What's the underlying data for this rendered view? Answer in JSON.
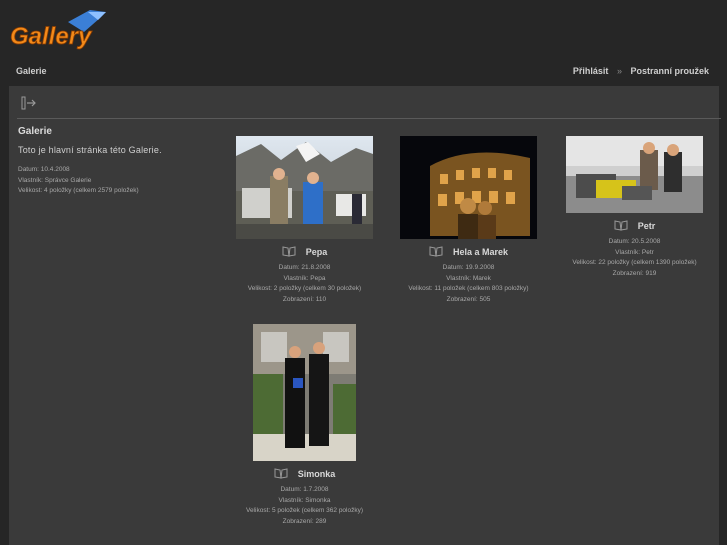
{
  "header": {
    "logo_text": "Gallery",
    "breadcrumb": "Galerie",
    "login_label": "Přihlásit",
    "separator": "»",
    "sidebar_label": "Postranní proužek"
  },
  "album": {
    "title": "Galerie",
    "description": "Toto je hlavní stránka této Galerie.",
    "date": "Datum: 10.4.2008",
    "owner": "Vlastník: Správce Galerie",
    "size": "Velikost: 4 položky (celkem 2579 položek)"
  },
  "items": [
    {
      "title": "Pepa",
      "date": "Datum: 21.8.2008",
      "owner": "Vlastník: Pepa",
      "size": "Velikost: 2 položky (celkem 30 položek)",
      "views": "Zobrazení: 110"
    },
    {
      "title": "Hela a Marek",
      "date": "Datum: 19.9.2008",
      "owner": "Vlastník: Marek",
      "size": "Velikost: 11 položek (celkem 803 položky)",
      "views": "Zobrazení: 505"
    },
    {
      "title": "Petr",
      "date": "Datum: 20.5.2008",
      "owner": "Vlastník: Petr",
      "size": "Velikost: 22 položky (celkem 1390 položek)",
      "views": "Zobrazení: 919"
    },
    {
      "title": "Simonka",
      "date": "Datum: 1.7.2008",
      "owner": "Vlastník: Simonka",
      "size": "Velikost: 5 položek (celkem 362 položky)",
      "views": "Zobrazení: 289"
    }
  ]
}
